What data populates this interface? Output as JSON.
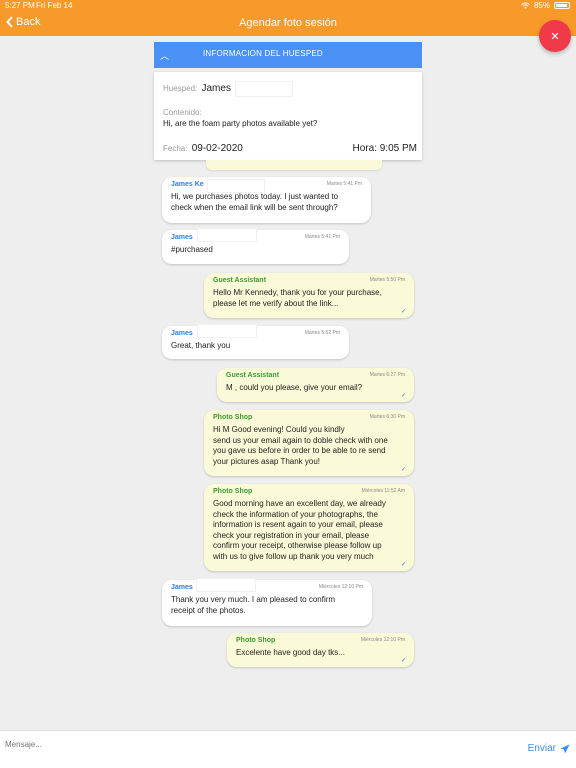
{
  "status": {
    "time": "5:27 PM",
    "date": "Fri Feb 14",
    "battery": "85%"
  },
  "nav": {
    "back_label": "Back",
    "title": "Agendar foto sesión"
  },
  "info": {
    "header": "INFORMACION DEL HUESPED",
    "guest_label": "Huesped:",
    "guest_name": "James",
    "content_label": "Contenido:",
    "content_text": "Hi, are the foam party photos available yet?",
    "date_label": "Fecha:",
    "date_value": "09-02-2020",
    "time_text": "Hora: 9:05 PM"
  },
  "messages": [
    {
      "direction": "in",
      "name": "James Ke",
      "stamp": "Martes 5:41 Pm",
      "text": "Hi, we purchases photos today. I just wanted to\ncheck when the email link will be sent through?"
    },
    {
      "direction": "in",
      "name": "James",
      "stamp": "Martes 5:41 Pm",
      "text": "#purchased"
    },
    {
      "direction": "out",
      "name": "Guest Assistant",
      "stamp": "Martes 5:50 Pm",
      "text": "Hello Mr Kennedy, thank you for your purchase,\nplease let me verify about the link..."
    },
    {
      "direction": "in",
      "name": "James",
      "stamp": "Martes 5:52 Pm",
      "text": "Great, thank you"
    },
    {
      "direction": "out",
      "name": "Guest Assistant",
      "stamp": "Martes 6:27 Pm",
      "text": "M            , could you please, give your email?"
    },
    {
      "direction": "out",
      "name": "Photo Shop",
      "stamp": "Martes 6:30 Pm",
      "text": "Hi M          Good evening! Could you kindly\nsend us your email again to doble check with one\nyou gave us before in order to be able to re send\nyour pictures asap Thank you!"
    },
    {
      "direction": "out",
      "name": "Photo Shop",
      "stamp": "Miércoles 11:52 Am",
      "text": "Good morning have an excellent day, we already\ncheck the information of your photographs, the\ninformation is resent again to your email, please\ncheck your registration in your email, please\nconfirm your receipt, otherwise please follow up\nwith us to give follow up thank you very much"
    },
    {
      "direction": "in",
      "name": "James",
      "stamp": "Miércoles 12:10 Pm",
      "text": "Thank you very much. I am pleased to confirm\nreceipt of the photos."
    },
    {
      "direction": "out",
      "name": "Photo Shop",
      "stamp": "Miércoles 12:10 Pm",
      "text": "Excelente have good day tks..."
    }
  ],
  "compose": {
    "placeholder": "Mensaje...",
    "send_label": "Enviar"
  },
  "icons": {
    "back": "chevron-left-icon",
    "close": "close-icon",
    "collapse": "chevron-up-icon",
    "send": "send-icon",
    "read": "check-icon"
  },
  "colors": {
    "nav": "#f79a2a",
    "info_header": "#4a90f5",
    "close_fab": "#f03a4a",
    "incoming_name": "#2a7de0",
    "outgoing_name": "#3a9a32",
    "outgoing_bubble": "#fafad8"
  }
}
